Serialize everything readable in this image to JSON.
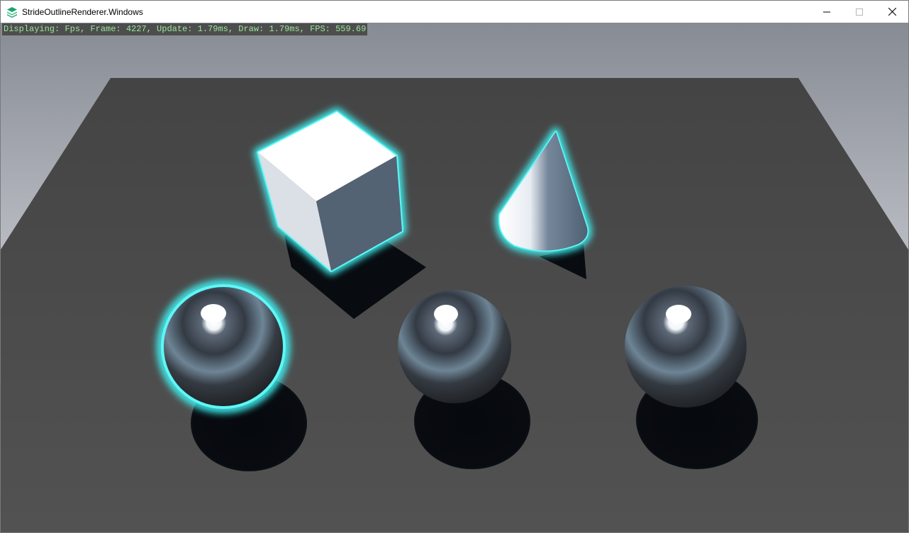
{
  "window": {
    "title": "StrideOutlineRenderer.Windows",
    "icon": "stride-logo-icon",
    "controls": [
      "minimize-icon",
      "maximize-icon",
      "close-icon"
    ]
  },
  "viewport": {
    "profiler_text": "Displaying: Fps, Frame: 4227, Update: 1.79ms, Draw: 1.79ms, FPS: 559.69",
    "colors": {
      "sky_top": "#8a8e96",
      "sky_bottom": "#c3c6cc",
      "ground": "#4b4b4b",
      "outline": "#3ff0f0",
      "overlay_text": "#9ae69a"
    },
    "objects": [
      {
        "name": "cube",
        "outlined": true
      },
      {
        "name": "cone",
        "outlined": true
      },
      {
        "name": "sphere-left",
        "outlined": true
      },
      {
        "name": "sphere-middle",
        "outlined": false
      },
      {
        "name": "sphere-right",
        "outlined": false
      }
    ]
  }
}
